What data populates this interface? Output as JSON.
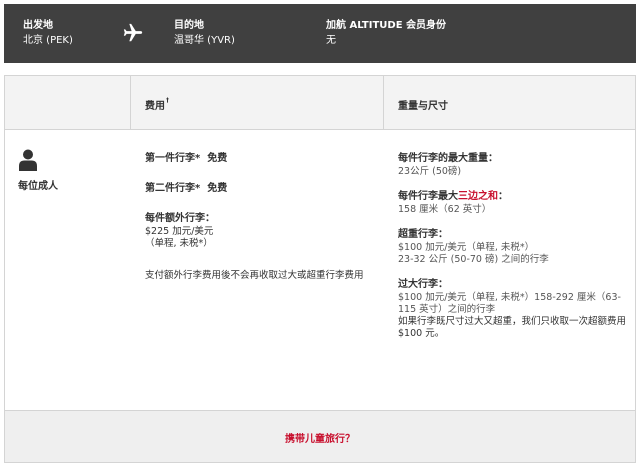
{
  "header": {
    "origin_label": "出发地",
    "origin_value": "北京 (PEK)",
    "plane_icon": "airplane-icon",
    "destination_label": "目的地",
    "destination_value": "温哥华 (YVR)",
    "status_label": "加航 ALTITUDE 会员身份",
    "status_value": "无",
    "bg_color": "#404040"
  },
  "table": {
    "col_fees_header": "费用",
    "col_fees_marker": "†",
    "col_weight_header": "重量与尺寸",
    "passenger_icon": "person-icon",
    "passenger_label": "每位成人",
    "fees": {
      "first_bag_label": "第一件行李",
      "first_bag_marker": "*",
      "first_bag_value": "免费",
      "second_bag_label": "第二件行李",
      "second_bag_marker": "*",
      "second_bag_value": "免费",
      "extra_label": "每件额外行李：",
      "extra_price": "$225 加元/美元",
      "extra_detail": "（单程, 未税*）",
      "note": "支付额外行李费用後不会再收取过大或超重行李费用"
    },
    "weight": {
      "max_weight_label": "每件行李的最大重量：",
      "max_weight_value": "23公斤 (50磅)",
      "max_dim_label_prefix": "每件行李最大",
      "max_dim_label_highlight": "三边之和",
      "max_dim_label_suffix": "：",
      "max_dim_value": "158 厘米（62 英寸）",
      "overweight_label": "超重行李：",
      "overweight_price": "$100 加元/美元（单程, 未税*）",
      "overweight_range": "23-32 公斤 (50-70 磅) 之间的行李",
      "oversize_label": "过大行李：",
      "oversize_text": "$100 加元/美元（单程, 未税*）158-292 厘米（63-115 英寸）之间的行李",
      "oversize_note": "如果行李既尺寸过大又超重，我们只收取一次超额费用 $100 元。"
    },
    "accent_color": "#c8102e"
  },
  "footer": {
    "link_text": "携带儿童旅行？"
  }
}
